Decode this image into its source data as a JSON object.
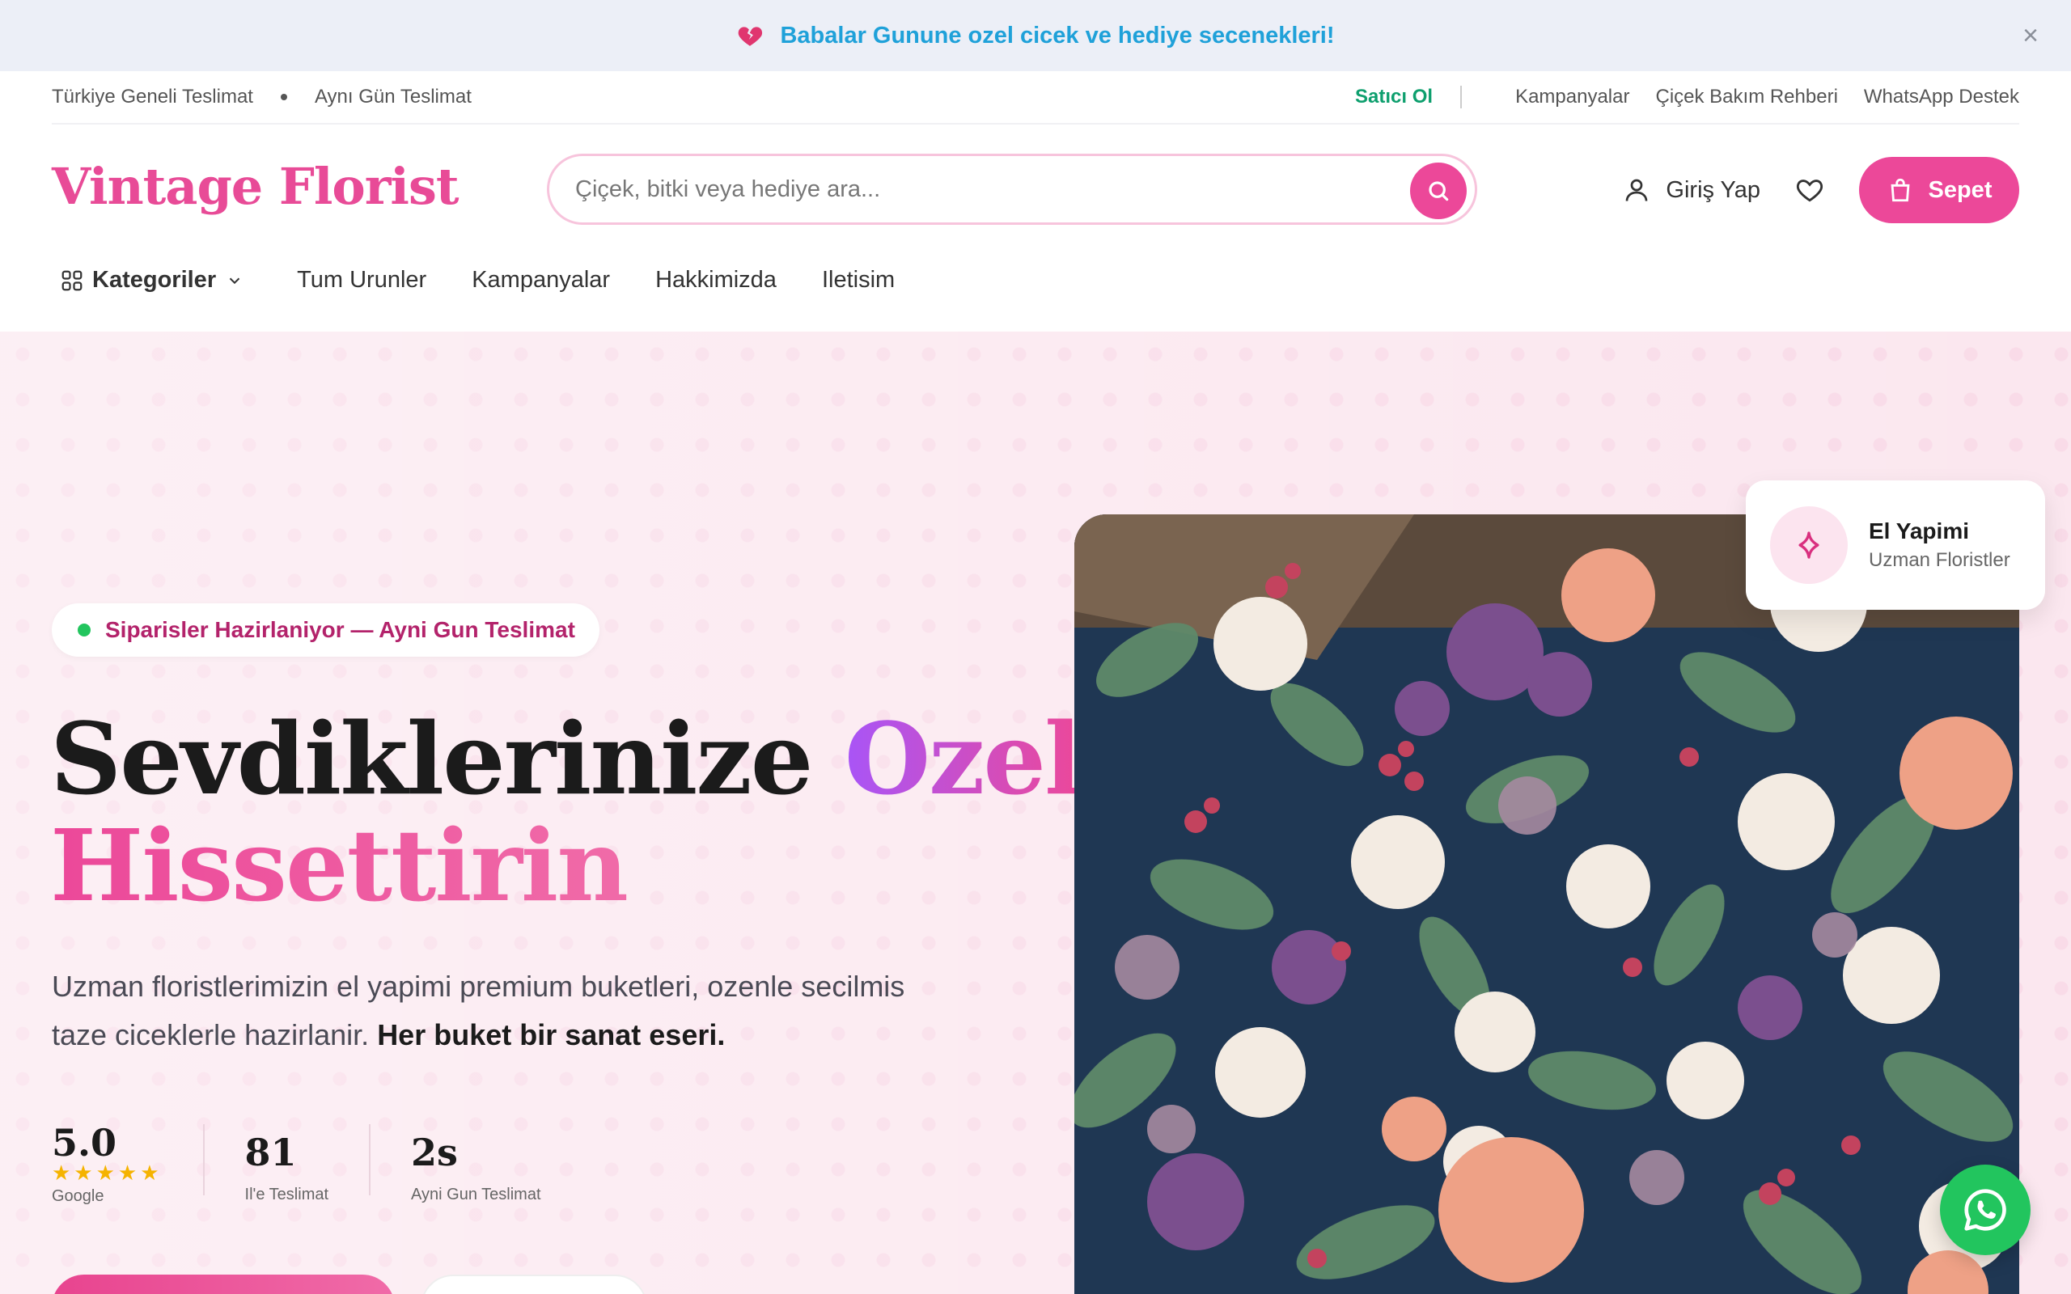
{
  "announcement": {
    "text": "Babalar Gunune ozel cicek ve hediye secenekleri!",
    "icon": "broken-heart-icon"
  },
  "utility": {
    "left_items": [
      "Türkiye Geneli Teslimat",
      "Aynı Gün Teslimat"
    ],
    "seller_label": "Satıcı Ol",
    "right_links": [
      "Kampanyalar",
      "Çiçek Bakım Rehberi",
      "WhatsApp Destek"
    ]
  },
  "header": {
    "logo": "Vintage Florist",
    "search_placeholder": "Çiçek, bitki veya hediye ara...",
    "login_label": "Giriş Yap",
    "cart_label": "Sepet"
  },
  "nav": {
    "categories_label": "Kategoriler",
    "items": [
      "Tum Urunler",
      "Kampanyalar",
      "Hakkimizda",
      "Iletisim"
    ]
  },
  "hero": {
    "badge": "Siparisler Hazirlaniyor — Ayni Gun Teslimat",
    "title_part1": "Sevdiklerinize",
    "title_part2": "Ozel",
    "title_part3": "Hissettirin",
    "desc_plain": "Uzman floristlerimizin el yapimi premium buketleri, ozenle secilmis taze ciceklerle hazirlanir.",
    "desc_bold": "Her buket bir sanat eseri.",
    "stats": [
      {
        "value": "5.0",
        "label": "Google",
        "stars": "★★★★★"
      },
      {
        "value": "81",
        "label": "Il'e Teslimat"
      },
      {
        "value": "2s",
        "label": "Ayni Gun Teslimat"
      }
    ],
    "rating": 5,
    "float_card": {
      "title": "El Yapimi",
      "subtitle": "Uzman Floristler"
    }
  },
  "colors": {
    "brand_pink": "#ec4899",
    "accent_purple": "#a855f7",
    "seller_green": "#0e9f6e",
    "whatsapp_green": "#22c55e",
    "announce_blue": "#1fa1d9"
  }
}
